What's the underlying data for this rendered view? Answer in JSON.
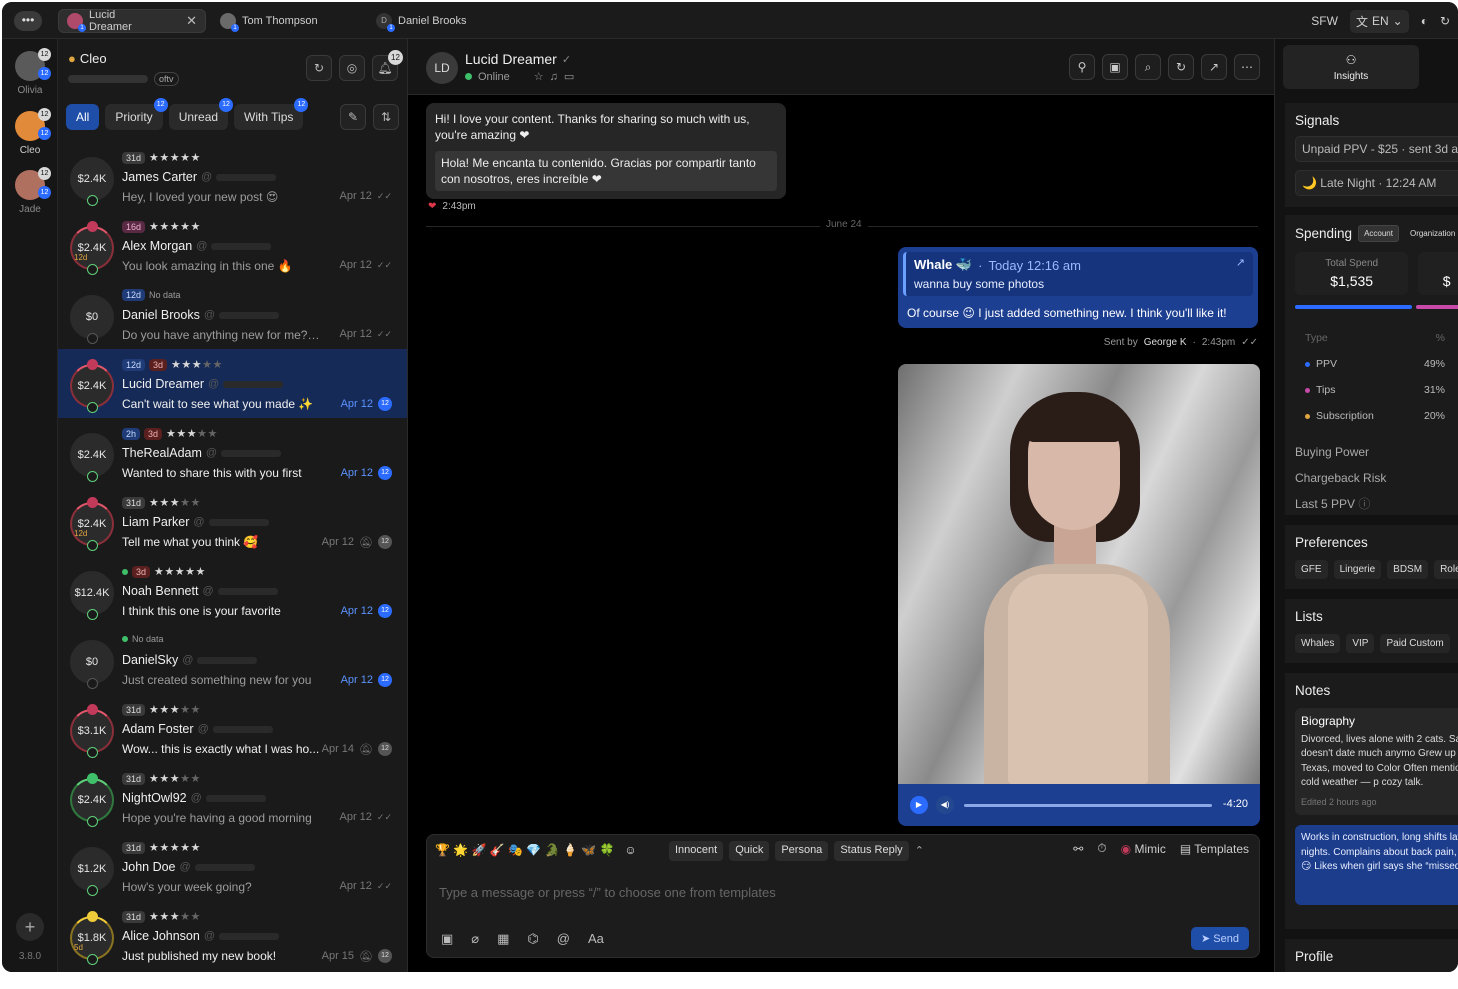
{
  "topbar": {
    "tabs": [
      {
        "label": "Lucid Dreamer",
        "active": true
      },
      {
        "label": "Tom Thompson",
        "active": false
      },
      {
        "label": "Daniel Brooks",
        "active": false
      }
    ],
    "sfw": "SFW",
    "lang": "EN"
  },
  "rail": {
    "accounts": [
      {
        "name": "Olivia",
        "badge": "12"
      },
      {
        "name": "Cleo",
        "badge": "12"
      },
      {
        "name": "Jade",
        "badge": "12"
      }
    ],
    "version": "3.8.0"
  },
  "list": {
    "me": {
      "name": "Cleo",
      "tag": "oftv"
    },
    "notif_count": "12",
    "filters": [
      {
        "label": "All",
        "badge": ""
      },
      {
        "label": "Priority",
        "badge": "12"
      },
      {
        "label": "Unread",
        "badge": "12"
      },
      {
        "label": "With Tips",
        "badge": "12"
      }
    ],
    "rows": [
      {
        "spend": "$2.4K",
        "chip": "31d",
        "chip2": "",
        "stars": "★★★★★",
        "dim": "",
        "name": "James Carter",
        "msg": "Hey, I loved your new post 😍",
        "date": "Apr 12",
        "count": ""
      },
      {
        "spend": "$2.4K",
        "chip": "16d",
        "chip2": "",
        "stars": "★★★★★",
        "dim": "",
        "name": "Alex Morgan",
        "msg": "You look amazing in this one 🔥",
        "date": "Apr 12",
        "count": "",
        "tag": "12d"
      },
      {
        "spend": "$0",
        "chip": "12d",
        "chip2": "No data",
        "stars": "",
        "dim": "",
        "name": "Daniel Brooks",
        "msg": "Do you have anything new for me? 😏",
        "date": "Apr 12",
        "count": ""
      },
      {
        "spend": "$2.4K",
        "chip": "12d",
        "chip2": "3d",
        "stars": "★★★",
        "dim": "★★",
        "name": "Lucid Dreamer",
        "msg": "Can't wait to see what you made ✨",
        "date": "Apr 12",
        "count": "12"
      },
      {
        "spend": "$2.4K",
        "chip": "2h",
        "chip2": "3d",
        "stars": "★★★",
        "dim": "★★",
        "name": "TheRealAdam",
        "msg": "Wanted to share this with you first",
        "date": "Apr 12",
        "count": "12"
      },
      {
        "spend": "$2.4K",
        "chip": "31d",
        "chip2": "",
        "stars": "★★★",
        "dim": "★★",
        "name": "Liam Parker",
        "msg": "Tell me what you think 🥰",
        "date": "Apr 12",
        "count": "12",
        "tag": "12d"
      },
      {
        "spend": "$12.4K",
        "chip": "3d",
        "chip2": "",
        "stars": "★★★★★",
        "dim": "",
        "name": "Noah Bennett",
        "msg": "I think this one is your favorite",
        "date": "Apr 12",
        "count": "12"
      },
      {
        "spend": "$0",
        "chip": "",
        "chip2": "No data",
        "stars": "",
        "dim": "",
        "name": "DanielSky",
        "msg": "Just created something new for you",
        "date": "Apr 12",
        "count": "12"
      },
      {
        "spend": "$3.1K",
        "chip": "31d",
        "chip2": "",
        "stars": "★★★",
        "dim": "★★",
        "name": "Adam Foster",
        "msg": "Wow... this is exactly what I was ho...",
        "date": "Apr 14",
        "count": "12"
      },
      {
        "spend": "$2.4K",
        "chip": "31d",
        "chip2": "",
        "stars": "★★★",
        "dim": "★★",
        "name": "NightOwl92",
        "msg": "Hope you're having a good morning",
        "date": "Apr 12",
        "count": ""
      },
      {
        "spend": "$1.2K",
        "chip": "31d",
        "chip2": "",
        "stars": "★★★★★",
        "dim": "",
        "name": "John Doe",
        "msg": "How's your week going?",
        "date": "Apr 12",
        "count": ""
      },
      {
        "spend": "$1.8K",
        "chip": "31d",
        "chip2": "",
        "stars": "★★★",
        "dim": "★★",
        "name": "Alice Johnson",
        "msg": "Just published my new book!",
        "date": "Apr 15",
        "count": "12",
        "tag": "5d"
      }
    ]
  },
  "chat": {
    "initials": "LD",
    "name": "Lucid Dreamer",
    "status": "Online",
    "in_msg": "Hi! I love your content. Thanks for sharing so much with us, you're amazing ❤",
    "in_trans": "Hola! Me encanta tu contenido. Gracias por compartir tanto con nosotros, eres increíble ❤",
    "in_time": "2:43pm",
    "divider": "June 24",
    "quote_name": "Whale 🐳",
    "quote_time": "Today 12:16 am",
    "quote_text": "wanna buy some photos",
    "out_msg": "Of course 😉 I just added something new. I think you'll like it!",
    "sent_by_label": "Sent by",
    "sent_by": "George K",
    "out_time": "2:43pm",
    "player_time": "-4:20",
    "quick": [
      "Innocent",
      "Quick",
      "Persona",
      "Status Reply"
    ],
    "emojis": "🏆 🌟 🚀 🎸 🎭 💎 🐊 🍦 🦋 🍀",
    "mimic": "Mimic",
    "templates": "Templates",
    "placeholder": "Type a message or press “/” to choose one from templates",
    "send": "Send"
  },
  "side": {
    "insights": "Insights",
    "signals_title": "Signals",
    "signal1": "Unpaid PPV - $25 · sent 3d a",
    "signal2": "🌙 Late Night · 12:24 AM",
    "spending_title": "Spending",
    "seg_account": "Account",
    "seg_org": "Organization",
    "total_label": "Total Spend",
    "total_value": "$1,535",
    "total2": "$",
    "type_h": "Type",
    "pct_h": "%",
    "types": [
      {
        "name": "PPV",
        "pct": "49%",
        "color": "#2b6bff"
      },
      {
        "name": "Tips",
        "pct": "31%",
        "color": "#c84aa8"
      },
      {
        "name": "Subscription",
        "pct": "20%",
        "color": "#e0a640"
      }
    ],
    "buying_power": "Buying Power",
    "chargeback": "Chargeback Risk",
    "last5": "Last 5 PPV",
    "prefs_title": "Preferences",
    "prefs": [
      "GFE",
      "Lingerie",
      "BDSM",
      "Role"
    ],
    "lists_title": "Lists",
    "lists": [
      "Whales",
      "VIP",
      "Paid Custom"
    ],
    "notes_title": "Notes",
    "bio_title": "Biography",
    "bio": "Divorced, lives alone with 2 cats. Says he doesn't date much anymo Grew up in Texas, moved to Color Often mentions cold weather — p cozy talk.",
    "bio_edit": "Edited 2 hours ago",
    "note2": "Works in construction, long shifts late nights. Complains about back pain, uses 😏 Likes when girl says she “missed",
    "profile": "Profile"
  }
}
